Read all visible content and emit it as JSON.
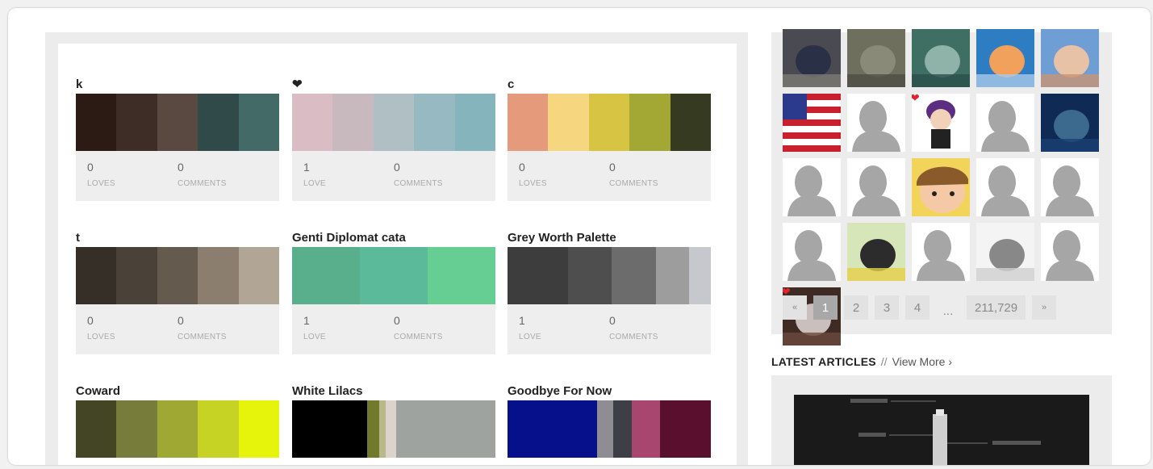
{
  "palettes": [
    {
      "title": "k",
      "colors": [
        "#2b1b14",
        "#3e2d26",
        "#5a4940",
        "#2f4a48",
        "#436a66"
      ],
      "widths": [
        1,
        1,
        1,
        1,
        1
      ],
      "loves": "0",
      "loves_label": "LOVES",
      "comments": "0",
      "comments_label": "COMMENTS"
    },
    {
      "title": "❤",
      "colors": [
        "#d9bcc4",
        "#c7b9be",
        "#afbfc3",
        "#97b9c1",
        "#86b4bd"
      ],
      "widths": [
        1,
        1,
        1,
        1,
        1
      ],
      "loves": "1",
      "loves_label": "LOVE",
      "comments": "0",
      "comments_label": "COMMENTS"
    },
    {
      "title": "c",
      "colors": [
        "#e59a7c",
        "#f6d67f",
        "#d7c443",
        "#a3a733",
        "#353a21"
      ],
      "widths": [
        1,
        1,
        1,
        1,
        1
      ],
      "loves": "0",
      "loves_label": "LOVES",
      "comments": "0",
      "comments_label": "COMMENTS"
    },
    {
      "title": "t",
      "colors": [
        "#362f27",
        "#4a4238",
        "#645a4d",
        "#8c7e6f",
        "#b1a595"
      ],
      "widths": [
        1,
        1,
        1,
        1,
        1
      ],
      "loves": "0",
      "loves_label": "LOVES",
      "comments": "0",
      "comments_label": "COMMENTS"
    },
    {
      "title": "Genti Diplomat cata",
      "colors": [
        "#59ae8c",
        "#5bba99",
        "#66ce93"
      ],
      "widths": [
        1,
        1,
        1
      ],
      "loves": "1",
      "loves_label": "LOVE",
      "comments": "0",
      "comments_label": "COMMENTS"
    },
    {
      "title": "Grey Worth Palette",
      "colors": [
        "#3d3d3d",
        "#4e4e4e",
        "#6c6c6c",
        "#9d9d9d",
        "#c7c8ce"
      ],
      "widths": [
        1.1,
        0.8,
        0.8,
        0.6,
        0.4
      ],
      "loves": "1",
      "loves_label": "LOVE",
      "comments": "0",
      "comments_label": "COMMENTS"
    },
    {
      "title": "Coward",
      "colors": [
        "#434525",
        "#777c3a",
        "#9fa833",
        "#c6d324",
        "#e5f40a"
      ],
      "widths": [
        1,
        1,
        1,
        1,
        1
      ],
      "loves": "",
      "loves_label": "",
      "comments": "",
      "comments_label": ""
    },
    {
      "title": "White Lilacs",
      "colors": [
        "#000000",
        "#717a2c",
        "#b7b98b",
        "#dcd3cd",
        "#9ea39f"
      ],
      "widths": [
        3.6,
        0.6,
        0.3,
        0.5,
        4.8
      ],
      "loves": "",
      "loves_label": "",
      "comments": "",
      "comments_label": ""
    },
    {
      "title": "Goodbye For Now",
      "colors": [
        "#06108a",
        "#8d8d93",
        "#3e3e47",
        "#a94670",
        "#5a0f2f"
      ],
      "widths": [
        4.4,
        0.8,
        0.9,
        1.4,
        2.5
      ],
      "loves": "",
      "loves_label": "",
      "comments": "",
      "comments_label": ""
    }
  ],
  "avatars": [
    {
      "name": "dog-photo-avatar",
      "kind": "photo",
      "colors": [
        "#4a4a52",
        "#2a3045",
        "#7d7a75"
      ],
      "heart": false
    },
    {
      "name": "outdoor-photo-avatar",
      "kind": "photo",
      "colors": [
        "#6e6f5d",
        "#8a8a78",
        "#4d4f44"
      ],
      "heart": false
    },
    {
      "name": "plant-photo-avatar",
      "kind": "photo",
      "colors": [
        "#3f6f63",
        "#8fb3a8",
        "#2b4f48"
      ],
      "heart": false
    },
    {
      "name": "mushroom-photo-avatar",
      "kind": "photo",
      "colors": [
        "#2e7dc3",
        "#f2a15d",
        "#a8c8e8"
      ],
      "heart": false
    },
    {
      "name": "baby-photo-avatar",
      "kind": "photo",
      "colors": [
        "#6e9ed4",
        "#e8c2a7",
        "#c89472"
      ],
      "heart": false
    },
    {
      "name": "flag-avatar",
      "kind": "flag",
      "colors": [
        "#c8202f",
        "#ffffff",
        "#2b3a8c"
      ],
      "heart": false
    },
    {
      "name": "default-silhouette-avatar",
      "kind": "silhouette",
      "colors": [],
      "heart": false
    },
    {
      "name": "cartoon-character-avatar",
      "kind": "cartoon",
      "colors": [
        "#5b2e82",
        "#f1d2b8",
        "#222222"
      ],
      "heart": true
    },
    {
      "name": "default-silhouette-avatar",
      "kind": "silhouette",
      "colors": [],
      "heart": false
    },
    {
      "name": "artwork-avatar",
      "kind": "photo",
      "colors": [
        "#0e2a55",
        "#3c6a8e",
        "#1a4070"
      ],
      "heart": false
    },
    {
      "name": "default-silhouette-avatar",
      "kind": "silhouette",
      "colors": [],
      "heart": false
    },
    {
      "name": "default-silhouette-avatar",
      "kind": "silhouette",
      "colors": [],
      "heart": false
    },
    {
      "name": "cartoon-face-avatar",
      "kind": "cartoon2",
      "colors": [
        "#f3d45a",
        "#8a5a2b",
        "#f6c9a6"
      ],
      "heart": false
    },
    {
      "name": "default-silhouette-avatar",
      "kind": "silhouette",
      "colors": [],
      "heart": false
    },
    {
      "name": "default-silhouette-avatar",
      "kind": "silhouette",
      "colors": [],
      "heart": false
    },
    {
      "name": "default-silhouette-avatar",
      "kind": "silhouette",
      "colors": [],
      "heart": false
    },
    {
      "name": "illustration-avatar",
      "kind": "photo",
      "colors": [
        "#d6e6b8",
        "#2c2c2c",
        "#e6d04a"
      ],
      "heart": false
    },
    {
      "name": "default-silhouette-avatar",
      "kind": "silhouette",
      "colors": [],
      "heart": false
    },
    {
      "name": "skull-art-avatar",
      "kind": "photo",
      "colors": [
        "#f4f4f4",
        "#888888",
        "#cfcfcf"
      ],
      "heart": false
    },
    {
      "name": "default-silhouette-avatar",
      "kind": "silhouette",
      "colors": [],
      "heart": false
    },
    {
      "name": "cat-photo-avatar",
      "kind": "photo",
      "colors": [
        "#3d2b24",
        "#c9c0bd",
        "#6a4a3c"
      ],
      "heart": true
    }
  ],
  "pagination": {
    "prev": "«",
    "pages": [
      "1",
      "2",
      "3",
      "4"
    ],
    "ellipsis": "...",
    "last": "211,729",
    "next": "»"
  },
  "articles": {
    "heading": "LATEST ARTICLES",
    "separator": "//",
    "view_more": "View More ›"
  },
  "accent": {
    "heart": "#e0242e",
    "active_page": "#a8a8a8"
  }
}
